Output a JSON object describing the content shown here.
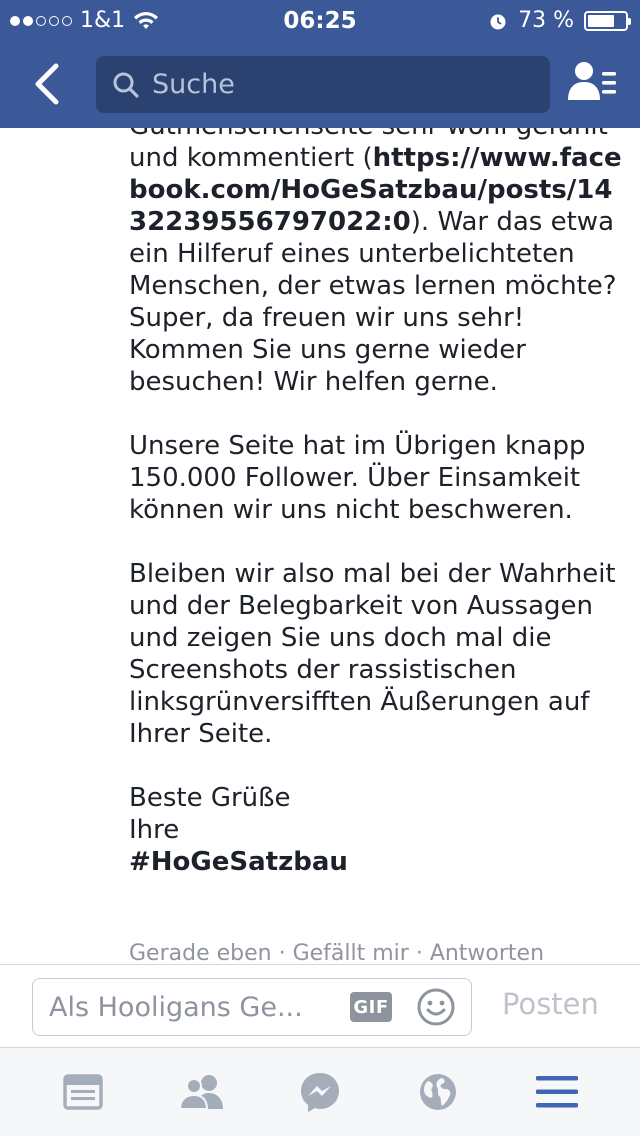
{
  "status_bar": {
    "carrier": "1&1",
    "time": "06:25",
    "battery_percent": "73 %",
    "battery_level": 0.73,
    "signal_bars_filled": 2,
    "signal_bars_total": 5
  },
  "header": {
    "search_placeholder": "Suche",
    "color": "#3b5998"
  },
  "comment": {
    "p1_text_a": "Gutmenschenseite sehr wohl gefühlt und kommentiert (",
    "p1_link": "https://www.facebook.com/HoGeSatzbau/posts/1432239556797022:0",
    "p1_text_b": "). War das etwa ein Hilferuf eines unterbelichteten Menschen, der etwas lernen möchte? Super, da freuen wir uns sehr! Kommen Sie uns gerne wieder besuchen! Wir helfen gerne.",
    "p2": "Unsere Seite hat im Übrigen knapp 150.000 Follower. Über Einsamkeit können wir uns nicht beschweren.",
    "p3": "Bleiben wir also mal bei der Wahrheit und der Belegbarkeit von Aussagen und zeigen Sie uns doch mal die Screenshots der rassistischen linksgrünversifften Äußerungen auf Ihrer Seite.",
    "sign_line1": "Beste Grüße",
    "sign_line2": "Ihre",
    "sign_hashtag": "#HoGeSatzbau",
    "meta_time": "Gerade eben",
    "meta_like": "Gefällt mir",
    "meta_reply": "Antworten",
    "meta_separator": " · "
  },
  "composer": {
    "placeholder": "Als Hooligans Ge...",
    "gif_label": "GIF",
    "post_label": "Posten"
  },
  "tabbar": {
    "items": [
      "news-feed",
      "friend-requests",
      "messenger",
      "notifications",
      "more"
    ],
    "active_color": "#4267b2",
    "inactive_color": "#a6adba"
  }
}
